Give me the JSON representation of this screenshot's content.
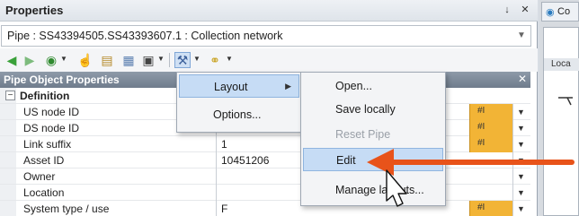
{
  "window": {
    "title": "Properties",
    "pin_glyph": "↓",
    "close_glyph": "✕"
  },
  "selector": {
    "value": "Pipe : SS43394505.SS43393607.1 : Collection network"
  },
  "toolbar": {
    "icons": [
      "back-arrow-icon",
      "forward-arrow-icon",
      "compass-icon",
      "pointer-hand-icon",
      "document-icon",
      "table-icon",
      "save-icon",
      "tools-icon",
      "key-icon"
    ]
  },
  "grid": {
    "header": "Pipe Object Properties",
    "close_glyph": "✕",
    "section_label": "Definition",
    "section_expander": "−",
    "rows": [
      {
        "label": "US node ID",
        "value": "",
        "flag": "#I"
      },
      {
        "label": "DS node ID",
        "value": "",
        "flag": "#I"
      },
      {
        "label": "Link suffix",
        "value": "1",
        "flag": "#I"
      },
      {
        "label": "Asset ID",
        "value": "10451206",
        "flag": ""
      },
      {
        "label": "Owner",
        "value": "",
        "flag": ""
      },
      {
        "label": "Location",
        "value": "",
        "flag": ""
      },
      {
        "label": "System type / use",
        "value": "F",
        "flag": "#I"
      }
    ]
  },
  "menu1": {
    "items": [
      {
        "label": "Layout",
        "submenu": true
      },
      {
        "label": "Options...",
        "submenu": false
      }
    ]
  },
  "menu2": {
    "items": [
      {
        "label": "Open...",
        "state": "normal"
      },
      {
        "label": "Save locally",
        "state": "normal"
      },
      {
        "label": "Reset Pipe",
        "state": "disabled"
      },
      {
        "label": "Edit",
        "state": "highlighted"
      },
      {
        "label": "Manage layouts...",
        "state": "normal"
      }
    ]
  },
  "side_window": {
    "tab_title": "Co",
    "panel_header": "Loca"
  },
  "colors": {
    "accent_arrow": "#e8531a",
    "flag_cell": "#f2b436",
    "menu_highlight": "#c6dcf5",
    "grid_header": "#7b8797"
  }
}
